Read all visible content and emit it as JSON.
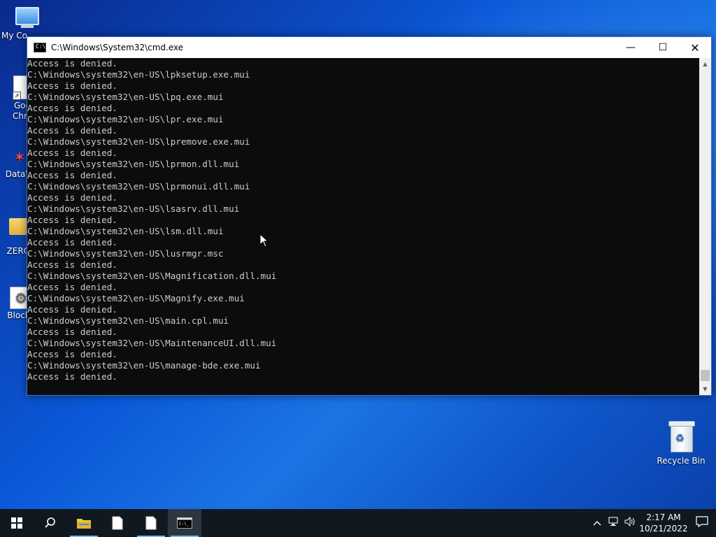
{
  "desktop": {
    "icons": [
      {
        "label": "My Co"
      },
      {
        "label": "Goo\nChro"
      },
      {
        "label": "DataW"
      },
      {
        "label": "ZERO."
      },
      {
        "label": "Blocke"
      },
      {
        "label": "Recycle Bin"
      }
    ]
  },
  "window": {
    "title": "C:\\Windows\\System32\\cmd.exe",
    "minimize": "—",
    "maximize": "☐",
    "close": "✕"
  },
  "console": {
    "lines": [
      "Access is denied.",
      "C:\\Windows\\system32\\en-US\\lpksetup.exe.mui",
      "Access is denied.",
      "C:\\Windows\\system32\\en-US\\lpq.exe.mui",
      "Access is denied.",
      "C:\\Windows\\system32\\en-US\\lpr.exe.mui",
      "Access is denied.",
      "C:\\Windows\\system32\\en-US\\lpremove.exe.mui",
      "Access is denied.",
      "C:\\Windows\\system32\\en-US\\lprmon.dll.mui",
      "Access is denied.",
      "C:\\Windows\\system32\\en-US\\lprmonui.dll.mui",
      "Access is denied.",
      "C:\\Windows\\system32\\en-US\\lsasrv.dll.mui",
      "Access is denied.",
      "C:\\Windows\\system32\\en-US\\lsm.dll.mui",
      "Access is denied.",
      "C:\\Windows\\system32\\en-US\\lusrmgr.msc",
      "Access is denied.",
      "C:\\Windows\\system32\\en-US\\Magnification.dll.mui",
      "Access is denied.",
      "C:\\Windows\\system32\\en-US\\Magnify.exe.mui",
      "Access is denied.",
      "C:\\Windows\\system32\\en-US\\main.cpl.mui",
      "Access is denied.",
      "C:\\Windows\\system32\\en-US\\MaintenanceUI.dll.mui",
      "Access is denied.",
      "C:\\Windows\\system32\\en-US\\manage-bde.exe.mui",
      "Access is denied."
    ]
  },
  "taskbar": {
    "clock_time": "2:17 AM",
    "clock_date": "10/21/2022"
  }
}
